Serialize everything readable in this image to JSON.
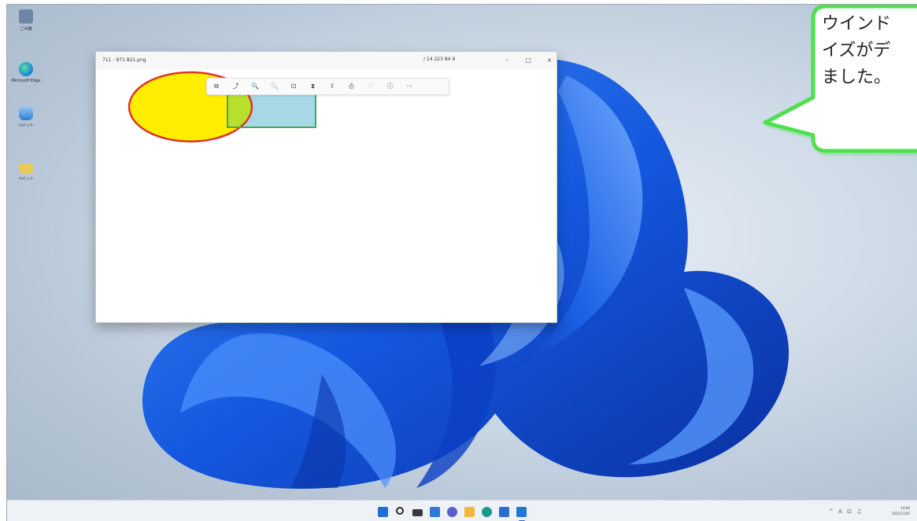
{
  "window": {
    "title": "711 - 971 821.png",
    "edit_label": "/ 14 223 84 9",
    "controls": {
      "minimize": "–",
      "maximize": "□",
      "close": "×"
    }
  },
  "toolbar_icons": [
    "copy-icon",
    "rotate-icon",
    "zoom-in-icon",
    "zoom-out-icon",
    "crop-icon",
    "adjust-icon",
    "share-icon",
    "print-icon",
    "favorite-icon",
    "info-icon",
    "more-icon"
  ],
  "toolbar_glyphs": [
    "⧉",
    "⤴",
    "🔍",
    "🔍",
    "⊡",
    "⧗",
    "⇪",
    "⎙",
    "♡",
    "ⓘ",
    "⋯"
  ],
  "desktop_icons": [
    {
      "name": "recycle-bin-icon",
      "label": "ごみ箱",
      "color": "#6d86a8"
    },
    {
      "name": "edge-icon",
      "label": "Microsoft Edge",
      "color": "#1b8fd6"
    },
    {
      "name": "paint-icon",
      "label": "ペイント",
      "color": "#2d7fd4"
    },
    {
      "name": "folder-icon",
      "label": "ペイント",
      "color": "#e9c95a"
    }
  ],
  "taskbar_icons": [
    {
      "name": "start-icon",
      "color": "#1f6fd6"
    },
    {
      "name": "search-icon",
      "color": "#2a2a2a"
    },
    {
      "name": "task-view-icon",
      "color": "#2a2a2a"
    },
    {
      "name": "widgets-icon",
      "color": "#2d78d8"
    },
    {
      "name": "chat-icon",
      "color": "#5b5fc7"
    },
    {
      "name": "file-explorer-icon",
      "color": "#f0b93a"
    },
    {
      "name": "edge-icon",
      "color": "#1a9a8c"
    },
    {
      "name": "store-icon",
      "color": "#2b6cd0"
    },
    {
      "name": "photos-icon",
      "color": "#2276d6"
    }
  ],
  "tray": {
    "icons_text": "^ A ⊡ ♫",
    "time": "10:00",
    "date": "2021/11/05"
  },
  "callout": {
    "text": "ウインド\nイズがデ\nました。",
    "border_color": "#4ee04e"
  },
  "colors": {
    "ellipse_fill": "#ffee00",
    "ellipse_stroke": "#e0322a",
    "rect_fill": "#a6d8e8",
    "overlap_fill": "#b6e02c",
    "rect_stroke": "#4aa84a"
  }
}
